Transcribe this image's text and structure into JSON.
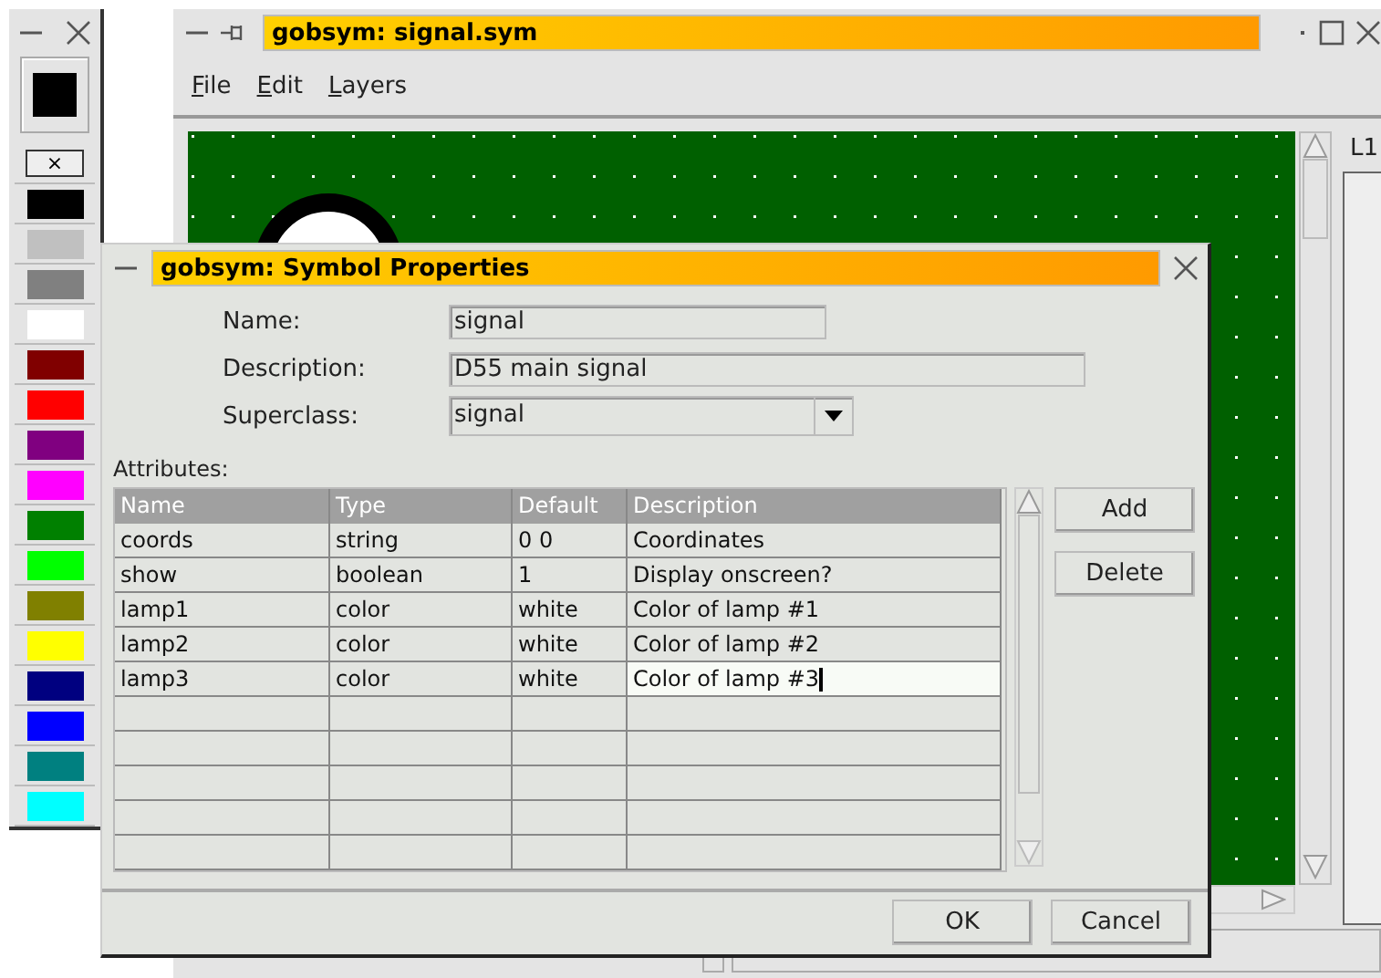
{
  "palette": {
    "current": {
      "color": "#000000"
    },
    "none_symbol": "×",
    "colors": [
      {
        "color": "#000000"
      },
      {
        "color": "#c0c0c0"
      },
      {
        "color": "#808080"
      },
      {
        "color": "#ffffff"
      },
      {
        "color": "#800000"
      },
      {
        "color": "#ff0000"
      },
      {
        "color": "#800080"
      },
      {
        "color": "#ff00ff"
      },
      {
        "color": "#008000"
      },
      {
        "color": "#00ff00"
      },
      {
        "color": "#808000"
      },
      {
        "color": "#ffff00"
      },
      {
        "color": "#000080"
      },
      {
        "color": "#0000ff"
      },
      {
        "color": "#008080"
      },
      {
        "color": "#00ffff"
      }
    ]
  },
  "main_window": {
    "title": "gobsym: signal.sym",
    "menu": [
      "File",
      "Edit",
      "Layers"
    ],
    "layer_panel": {
      "label": "L1"
    }
  },
  "dialog": {
    "title": "gobsym: Symbol Properties",
    "fields": [
      {
        "kind": "text",
        "label": "Name:",
        "value": "signal"
      },
      {
        "kind": "text",
        "label": "Description:",
        "value": "D55 main signal"
      },
      {
        "kind": "dropdown",
        "label": "Superclass:",
        "value": "signal"
      }
    ],
    "attributes_label": "Attributes:",
    "table": {
      "columns": [
        "Name",
        "Type",
        "Default",
        "Description"
      ],
      "rows": [
        {
          "cells": [
            "coords",
            "string",
            "0 0",
            "Coordinates"
          ],
          "editing": false
        },
        {
          "cells": [
            "show",
            "boolean",
            "1",
            "Display onscreen?"
          ],
          "editing": false
        },
        {
          "cells": [
            "lamp1",
            "color",
            "white",
            "Color of lamp #1"
          ],
          "editing": false
        },
        {
          "cells": [
            "lamp2",
            "color",
            "white",
            "Color of lamp #2"
          ],
          "editing": false
        },
        {
          "cells": [
            "lamp3",
            "color",
            "white",
            "Color of lamp #3"
          ],
          "editing": true
        }
      ]
    },
    "side_buttons": [
      "Add",
      "Delete"
    ],
    "buttons": [
      "OK",
      "Cancel"
    ]
  }
}
